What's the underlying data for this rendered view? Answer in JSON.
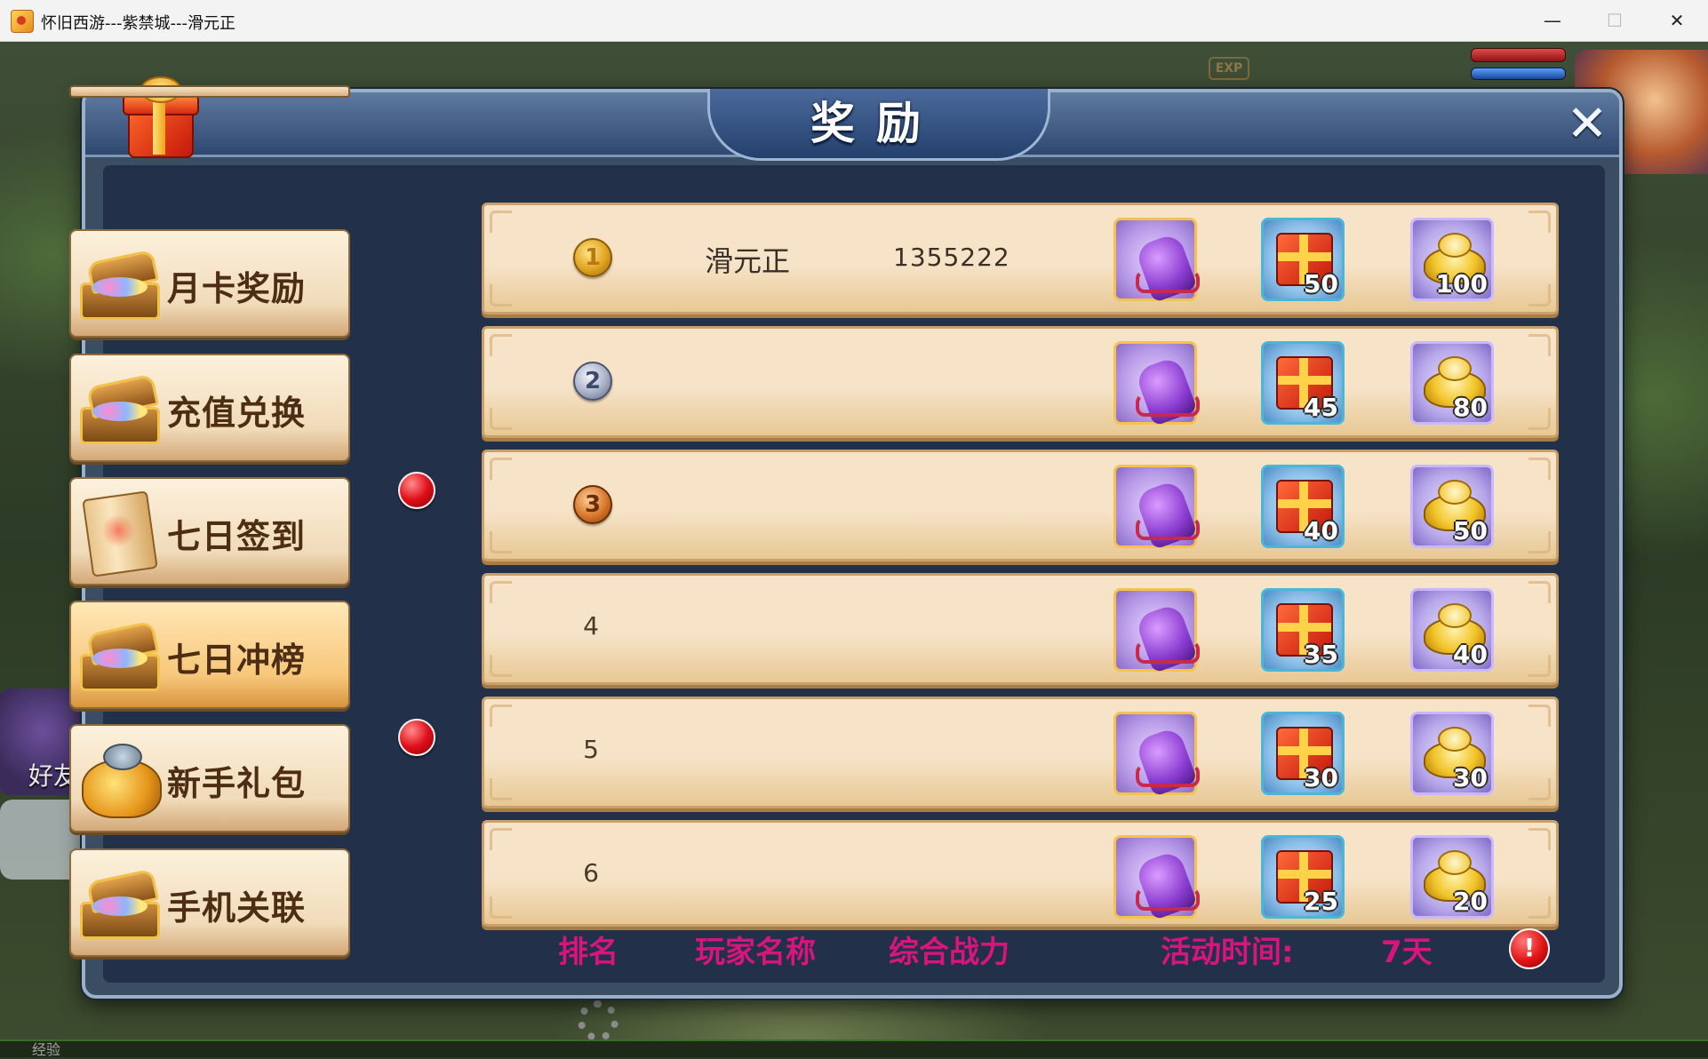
{
  "window": {
    "title": "怀旧西游---紫禁城---滑元正",
    "controls": {
      "minimize": "—",
      "maximize": "☐",
      "close": "✕"
    }
  },
  "game_hud": {
    "exp_badge": "EXP",
    "friend_label": "好友",
    "bottom_label": "经验"
  },
  "dialog": {
    "title": "奖励",
    "close_glyph": "✕"
  },
  "sidebar": {
    "items": [
      {
        "label": "月卡奖励",
        "icon": "treasure-chest-icon",
        "badge": false,
        "active": false
      },
      {
        "label": "充值兑换",
        "icon": "treasure-chest-icon",
        "badge": false,
        "active": false
      },
      {
        "label": "七日签到",
        "icon": "scroll-icon",
        "badge": true,
        "active": false
      },
      {
        "label": "七日冲榜",
        "icon": "treasure-chest-icon",
        "badge": false,
        "active": true
      },
      {
        "label": "新手礼包",
        "icon": "money-bag-icon",
        "badge": true,
        "active": false
      },
      {
        "label": "手机关联",
        "icon": "treasure-chest-icon",
        "badge": false,
        "active": false
      }
    ]
  },
  "rankings": {
    "rows": [
      {
        "rank": "1",
        "medal": "gold",
        "player": "滑元正",
        "power": "1355222",
        "gift_qty": "50",
        "ingot_qty": "100"
      },
      {
        "rank": "2",
        "medal": "silver",
        "player": "",
        "power": "",
        "gift_qty": "45",
        "ingot_qty": "80"
      },
      {
        "rank": "3",
        "medal": "bronze",
        "player": "",
        "power": "",
        "gift_qty": "40",
        "ingot_qty": "50"
      },
      {
        "rank": "4",
        "medal": "",
        "player": "",
        "power": "",
        "gift_qty": "35",
        "ingot_qty": "40"
      },
      {
        "rank": "5",
        "medal": "",
        "player": "",
        "power": "",
        "gift_qty": "30",
        "ingot_qty": "30"
      },
      {
        "rank": "6",
        "medal": "",
        "player": "",
        "power": "",
        "gift_qty": "25",
        "ingot_qty": "20"
      }
    ]
  },
  "footer": {
    "rank_header": "排名",
    "player_header": "玩家名称",
    "power_header": "综合战力",
    "time_label": "活动时间:",
    "time_value": "7天",
    "info_glyph": "!"
  },
  "colors": {
    "footer_text": "#d8157c",
    "row_bg": "#f6e3c8",
    "dialog_bg": "#3b4d62"
  }
}
